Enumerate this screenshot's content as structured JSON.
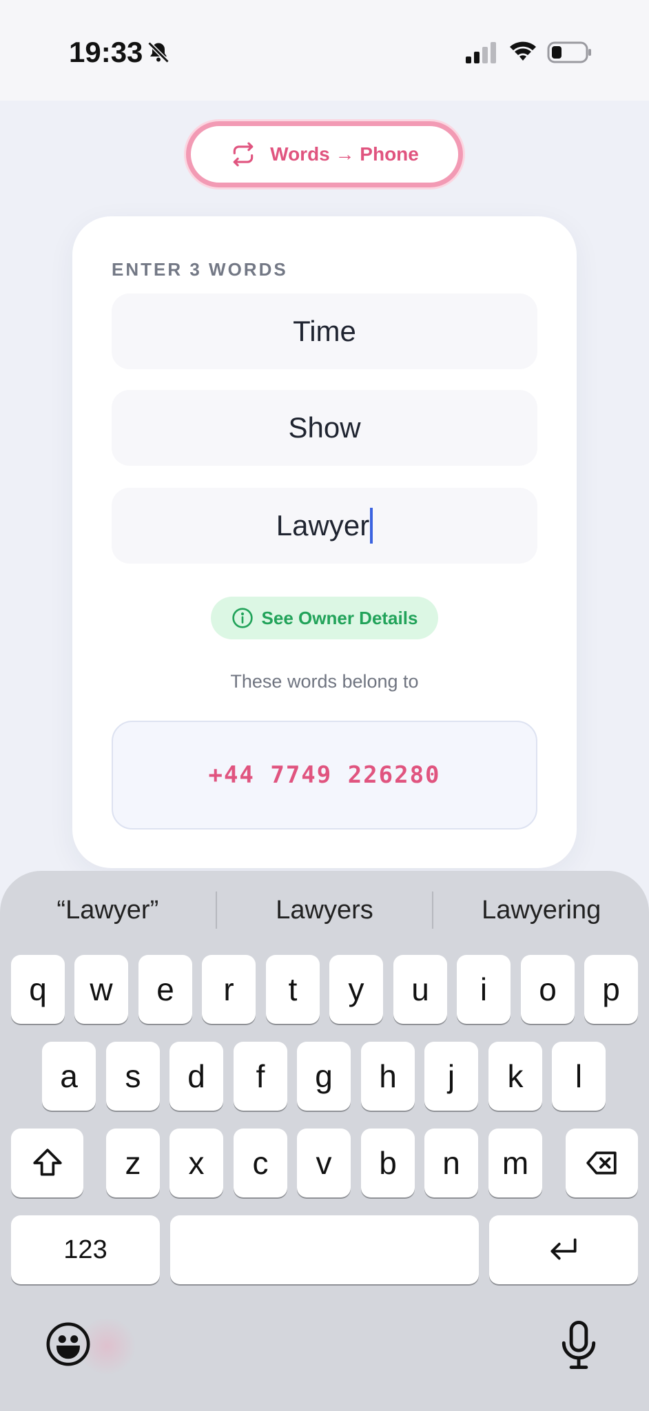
{
  "status_bar": {
    "time": "19:33",
    "icons": [
      "bell-slash-icon",
      "signal-icon",
      "wifi-icon",
      "battery-icon"
    ]
  },
  "mode_toggle": {
    "label": "Words → Phone",
    "icon": "swap-arrows-icon"
  },
  "card": {
    "label": "ENTER 3 WORDS",
    "words": [
      "Time",
      "Show",
      "Lawyer"
    ],
    "owner_button": "See Owner Details",
    "belong_text": "These words belong to",
    "phone_number": "+44 7749 226280"
  },
  "keyboard": {
    "suggestions": [
      "“Lawyer”",
      "Lawyers",
      "Lawyering"
    ],
    "rows": [
      [
        "q",
        "w",
        "e",
        "r",
        "t",
        "y",
        "u",
        "i",
        "o",
        "p"
      ],
      [
        "a",
        "s",
        "d",
        "f",
        "g",
        "h",
        "j",
        "k",
        "l"
      ],
      [
        "z",
        "x",
        "c",
        "v",
        "b",
        "n",
        "m"
      ]
    ],
    "numbers_key": "123",
    "space_key": "",
    "icons": [
      "shift-icon",
      "backspace-icon",
      "return-icon",
      "emoji-icon",
      "microphone-icon"
    ]
  },
  "colors": {
    "accent_pink": "#e0547f",
    "toggle_border": "#f29ab4",
    "success_green": "#22a35a",
    "caret_blue": "#3b63e0"
  }
}
